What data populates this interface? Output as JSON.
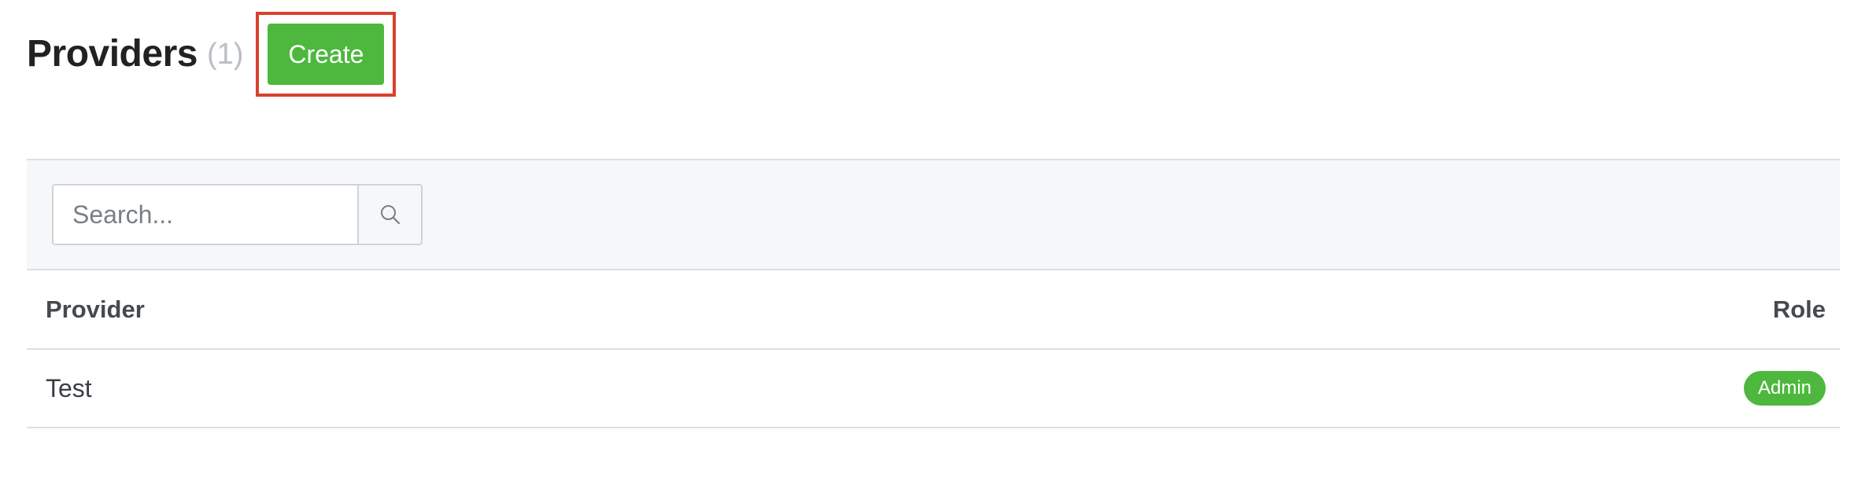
{
  "header": {
    "title": "Providers",
    "count": "(1)",
    "create_label": "Create"
  },
  "search": {
    "placeholder": "Search...",
    "value": ""
  },
  "table": {
    "columns": [
      "Provider",
      "Role"
    ],
    "rows": [
      {
        "provider": "Test",
        "role": "Admin"
      }
    ]
  },
  "colors": {
    "accent_green": "#4db83d",
    "highlight_red": "#d9412d"
  },
  "icons": {
    "search": "search-icon"
  }
}
